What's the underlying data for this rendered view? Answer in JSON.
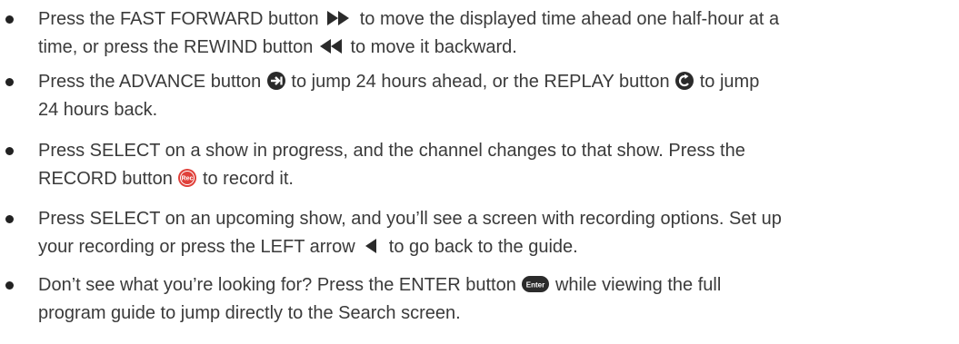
{
  "bullets": [
    {
      "line1_a": "Press the FAST FORWARD button ",
      "icon1": "fast-forward-icon",
      "line1_b": " to move the displayed time ahead one half-hour at a",
      "line2_a": "time, or press the REWIND button ",
      "icon2": "rewind-icon",
      "line2_b": " to move it backward."
    },
    {
      "line1_a": "Press the ADVANCE button ",
      "icon1": "advance-icon",
      "line1_b": " to jump 24 hours ahead, or the REPLAY button ",
      "icon2": "replay-icon",
      "line1_c": " to jump",
      "line2_a": "24 hours back."
    },
    {
      "line1_a": "Press SELECT on a show in progress, and the channel changes to that show. Press the",
      "line2_a": "RECORD button ",
      "icon1": "record-icon",
      "icon1_label": "Rec",
      "line2_b": " to record it."
    },
    {
      "line1_a": "Press SELECT on an upcoming show, and you’ll see a screen with recording options. Set up",
      "line2_a": "your recording or press the LEFT arrow ",
      "icon1": "left-arrow-icon",
      "line2_b": " to go back to the guide."
    },
    {
      "line1_a": "Don’t see what you’re looking for? Press the ENTER button ",
      "icon1": "enter-icon",
      "icon1_label": "Enter",
      "line1_b": " while viewing the full",
      "line2_a": "program guide to jump directly to the Search screen."
    }
  ],
  "colors": {
    "text": "#3a3a3a",
    "bullet": "#222222",
    "icon_dark": "#2b2b2b",
    "record_red": "#e0403a"
  }
}
